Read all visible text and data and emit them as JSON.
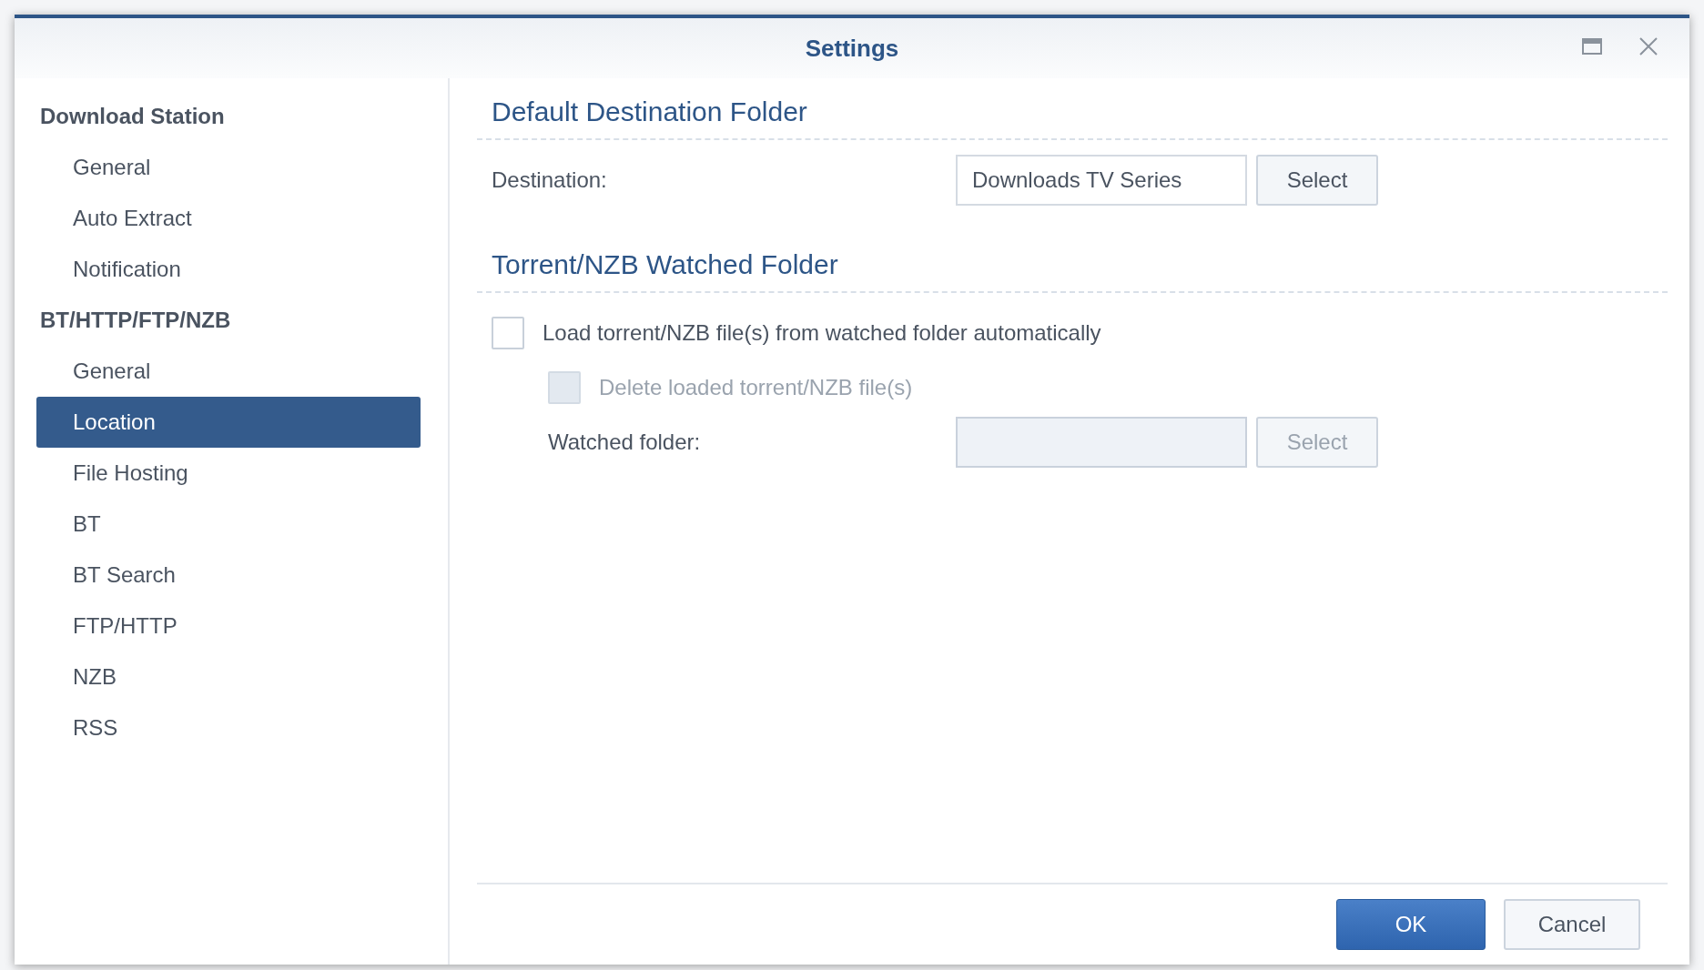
{
  "window": {
    "title": "Settings"
  },
  "sidebar": {
    "groups": [
      {
        "label": "Download Station",
        "items": [
          {
            "label": "General",
            "selected": false
          },
          {
            "label": "Auto Extract",
            "selected": false
          },
          {
            "label": "Notification",
            "selected": false
          }
        ]
      },
      {
        "label": "BT/HTTP/FTP/NZB",
        "items": [
          {
            "label": "General",
            "selected": false
          },
          {
            "label": "Location",
            "selected": true
          },
          {
            "label": "File Hosting",
            "selected": false
          },
          {
            "label": "BT",
            "selected": false
          },
          {
            "label": "BT Search",
            "selected": false
          },
          {
            "label": "FTP/HTTP",
            "selected": false
          },
          {
            "label": "NZB",
            "selected": false
          },
          {
            "label": "RSS",
            "selected": false
          }
        ]
      }
    ]
  },
  "sections": [
    {
      "title": "Default Destination Folder",
      "rows": [
        {
          "kind": "folder",
          "label": "Destination:",
          "value": "Downloads TV Series",
          "button": "Select",
          "disabled": false,
          "indented": false
        }
      ]
    },
    {
      "title": "Torrent/NZB Watched Folder",
      "rows": [
        {
          "kind": "checkbox",
          "label": "Load torrent/NZB file(s) from watched folder automatically",
          "checked": false,
          "disabled": false
        },
        {
          "kind": "sub_checkbox",
          "label": "Delete loaded torrent/NZB file(s)",
          "checked": false,
          "disabled": true
        },
        {
          "kind": "folder",
          "label": "Watched folder:",
          "button": "Select",
          "disabled": true,
          "indented": true
        }
      ]
    }
  ],
  "footer": {
    "buttons": [
      {
        "label": "OK",
        "kind": "primary"
      },
      {
        "label": "Cancel",
        "kind": "secondary"
      }
    ]
  }
}
